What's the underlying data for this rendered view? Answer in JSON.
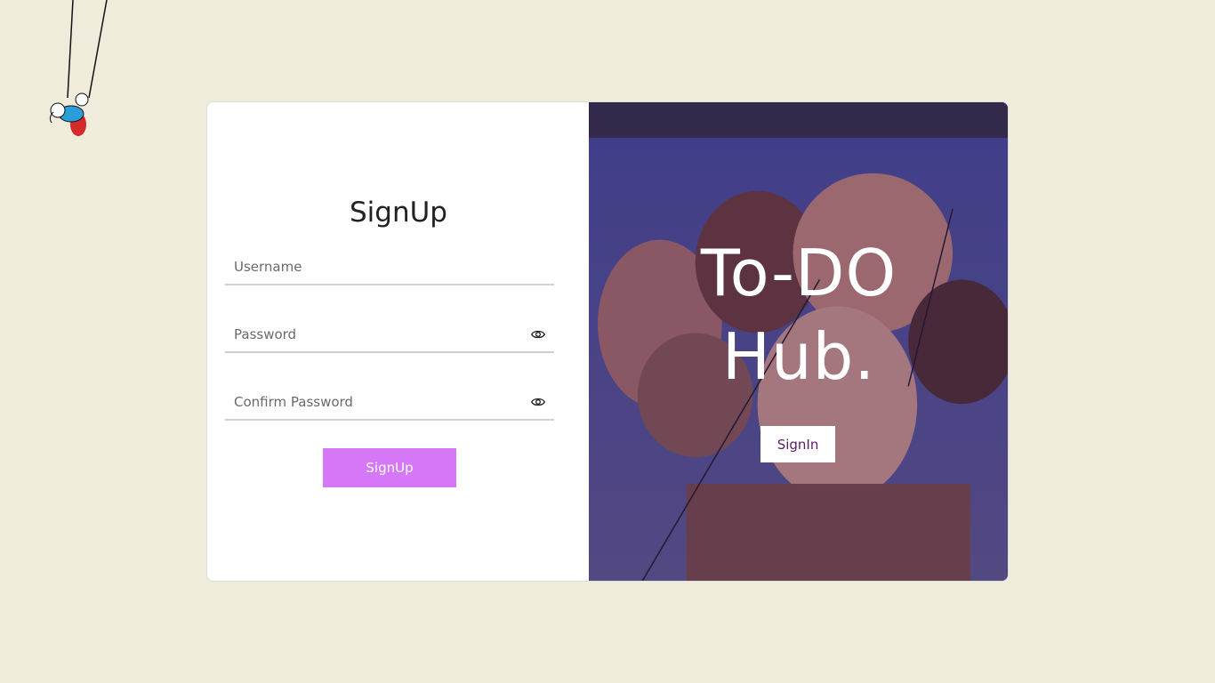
{
  "form": {
    "title": "SignUp",
    "username_placeholder": "Username",
    "password_placeholder": "Password",
    "confirm_placeholder": "Confirm Password",
    "submit_label": "SignUp"
  },
  "hero": {
    "brand_line1": "To-DO",
    "brand_line2": "Hub.",
    "signin_label": "SignIn"
  },
  "icons": {
    "password_toggle": "eye-icon",
    "confirm_toggle": "eye-icon",
    "decoration": "swing-illustration"
  },
  "colors": {
    "page_background": "#f0ecdc",
    "signup_button": "#d677f7",
    "signin_text": "#5a1a6a",
    "photo_overlay": "#46286e"
  }
}
